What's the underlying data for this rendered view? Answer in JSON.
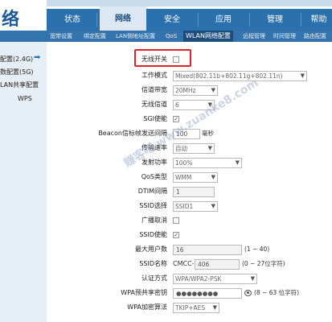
{
  "brand": "络",
  "nav": {
    "tabs": [
      {
        "label": "状态"
      },
      {
        "label": "网络"
      },
      {
        "label": "安全"
      },
      {
        "label": "应用"
      },
      {
        "label": "管理"
      },
      {
        "label": "帮助"
      }
    ],
    "active_tab": "网络"
  },
  "subnav": {
    "items": [
      {
        "label": "宽带设置"
      },
      {
        "label": "绑定配置"
      },
      {
        "label": "LAN侧地址配置"
      },
      {
        "label": "QoS"
      },
      {
        "label": "WLAN网络配置"
      },
      {
        "label": "远程管理"
      },
      {
        "label": "时间管理"
      },
      {
        "label": "路由配置"
      }
    ],
    "active": "WLAN网络配置"
  },
  "sidebar": {
    "items": [
      {
        "label": "配置(2.4G)"
      },
      {
        "label": "数配置(5G)"
      },
      {
        "label": "LAN共享配置"
      },
      {
        "label": "WPS"
      }
    ]
  },
  "form": {
    "wireless_switch": {
      "label": "无线开关",
      "checked": false
    },
    "mode": {
      "label": "工作模式",
      "value": "Mixed(802.11b+802.11g+802.11n)"
    },
    "bandwidth": {
      "label": "信道带宽",
      "value": "20MHz"
    },
    "channel": {
      "label": "无线信道",
      "value": "6"
    },
    "sgi": {
      "label": "SGI使能",
      "checked": true
    },
    "beacon": {
      "label": "Beacon信标帧发送间隔",
      "value": "100",
      "unit": "毫秒"
    },
    "rate": {
      "label": "传输速率",
      "value": "自动"
    },
    "power": {
      "label": "发射功率",
      "value": "100%"
    },
    "qos": {
      "label": "QoS类型",
      "value": "WMM"
    },
    "dtim": {
      "label": "DTIM间隔",
      "value": "1"
    },
    "ssid_select": {
      "label": "SSID选择",
      "value": "SSID1"
    },
    "broadcast_cancel": {
      "label": "广播取消",
      "checked": false
    },
    "ssid_enable": {
      "label": "SSID使能",
      "checked": true
    },
    "max_users": {
      "label": "最大用户数",
      "value": "16",
      "hint": "(1 ~ 40)"
    },
    "ssid_name": {
      "label": "SSID名称",
      "prefix": "CMCC-",
      "value": "406",
      "hint": "(0 ~ 27位字符)"
    },
    "auth": {
      "label": "认证方式",
      "value": "WPA/WPA2-PSK"
    },
    "psk": {
      "label": "WPA预共享密钥",
      "value": "●●●●●●●●",
      "hint": "(8 ~ 63 位字符)"
    },
    "encrypt": {
      "label": "WPA加密算法",
      "value": "TKIP+AES"
    }
  },
  "watermark": "赚客吧 www.zuanke8.com"
}
